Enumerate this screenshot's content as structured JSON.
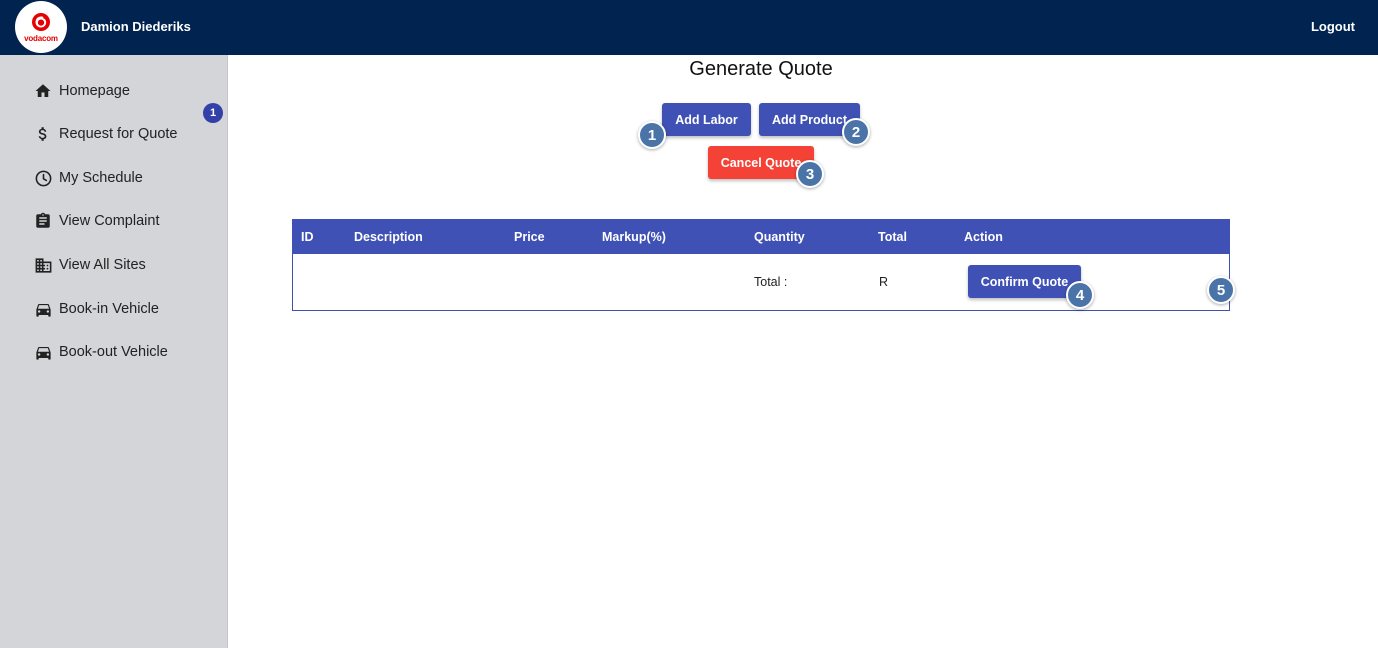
{
  "header": {
    "brand": "vodacom",
    "user_name": "Damion Diederiks",
    "logout_label": "Logout"
  },
  "sidebar": {
    "badge_count": "1",
    "items": [
      {
        "label": "Homepage",
        "icon": "home-icon"
      },
      {
        "label": "Request for Quote",
        "icon": "dollar-icon"
      },
      {
        "label": "My Schedule",
        "icon": "clock-icon"
      },
      {
        "label": "View Complaint",
        "icon": "clipboard-icon"
      },
      {
        "label": "View All Sites",
        "icon": "building-icon"
      },
      {
        "label": "Book-in Vehicle",
        "icon": "car-icon"
      },
      {
        "label": "Book-out Vehicle",
        "icon": "car-icon"
      }
    ]
  },
  "main": {
    "title": "Generate Quote",
    "add_labor_label": "Add Labor",
    "add_product_label": "Add Product",
    "cancel_quote_label": "Cancel Quote",
    "confirm_quote_label": "Confirm Quote",
    "table": {
      "columns": [
        "ID",
        "Description",
        "Price",
        "Markup(%)",
        "Quantity",
        "Total",
        "Action"
      ],
      "total_label": "Total :",
      "total_value": "R"
    }
  },
  "markers": [
    "1",
    "2",
    "3",
    "4",
    "5"
  ],
  "colors": {
    "topbar": "#00234f",
    "sidebar": "#d3d5d9",
    "primary": "#3f51b5",
    "danger": "#f44336",
    "marker": "#4a74a8",
    "brand_red": "#e60000"
  }
}
